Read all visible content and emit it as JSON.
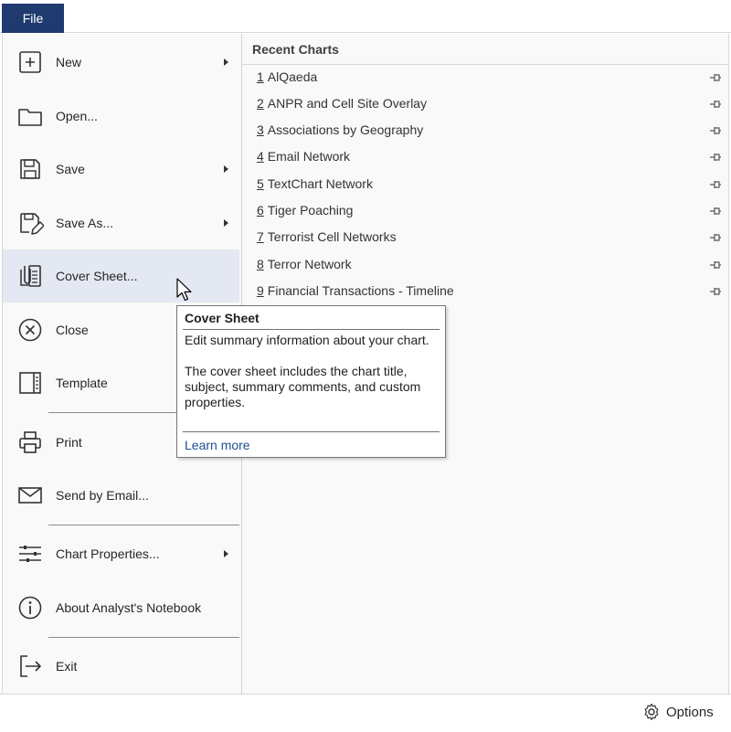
{
  "topbar": {
    "file_tab": "File"
  },
  "nav": {
    "items": [
      {
        "id": "new",
        "label": "New",
        "icon": "new-document-icon",
        "arrow": true
      },
      {
        "id": "open",
        "label": "Open...",
        "icon": "folder-icon",
        "arrow": false
      },
      {
        "id": "save",
        "label": "Save",
        "icon": "floppy-disk-icon",
        "arrow": true
      },
      {
        "id": "save-as",
        "label": "Save As...",
        "icon": "save-as-pencil-icon",
        "arrow": true
      },
      {
        "id": "cover-sheet",
        "label": "Cover Sheet...",
        "icon": "cover-sheet-icon",
        "arrow": false,
        "selected": true
      },
      {
        "id": "close",
        "label": "Close",
        "icon": "close-circle-icon",
        "arrow": false
      },
      {
        "id": "template",
        "label": "Template",
        "icon": "template-icon",
        "arrow": false
      },
      {
        "id": "print",
        "label": "Print",
        "icon": "printer-icon",
        "arrow": false
      },
      {
        "id": "send-email",
        "label": "Send by Email...",
        "icon": "envelope-icon",
        "arrow": false
      },
      {
        "id": "chart-properties",
        "label": "Chart Properties...",
        "icon": "sliders-icon",
        "arrow": true
      },
      {
        "id": "about",
        "label": "About Analyst's Notebook",
        "icon": "info-icon",
        "arrow": false
      },
      {
        "id": "exit",
        "label": "Exit",
        "icon": "exit-icon",
        "arrow": false
      }
    ]
  },
  "recent": {
    "title": "Recent Charts",
    "items": [
      {
        "num": "1",
        "name": "AlQaeda"
      },
      {
        "num": "2",
        "name": "ANPR and Cell Site Overlay"
      },
      {
        "num": "3",
        "name": "Associations by Geography"
      },
      {
        "num": "4",
        "name": "Email Network"
      },
      {
        "num": "5",
        "name": "TextChart Network"
      },
      {
        "num": "6",
        "name": "Tiger Poaching"
      },
      {
        "num": "7",
        "name": "Terrorist Cell Networks"
      },
      {
        "num": "8",
        "name": "Terror Network"
      },
      {
        "num": "9",
        "name": "Financial Transactions - Timeline"
      }
    ]
  },
  "tooltip": {
    "title": "Cover Sheet",
    "line1": "Edit summary information about your chart.",
    "line2": "The cover sheet includes the chart title, subject, summary comments, and custom properties.",
    "link": "Learn more"
  },
  "footer": {
    "options_label": "Options"
  },
  "colors": {
    "file_tab": "#1e3a6e",
    "selected_item": "#e3e8f3",
    "link": "#1d4f91"
  }
}
